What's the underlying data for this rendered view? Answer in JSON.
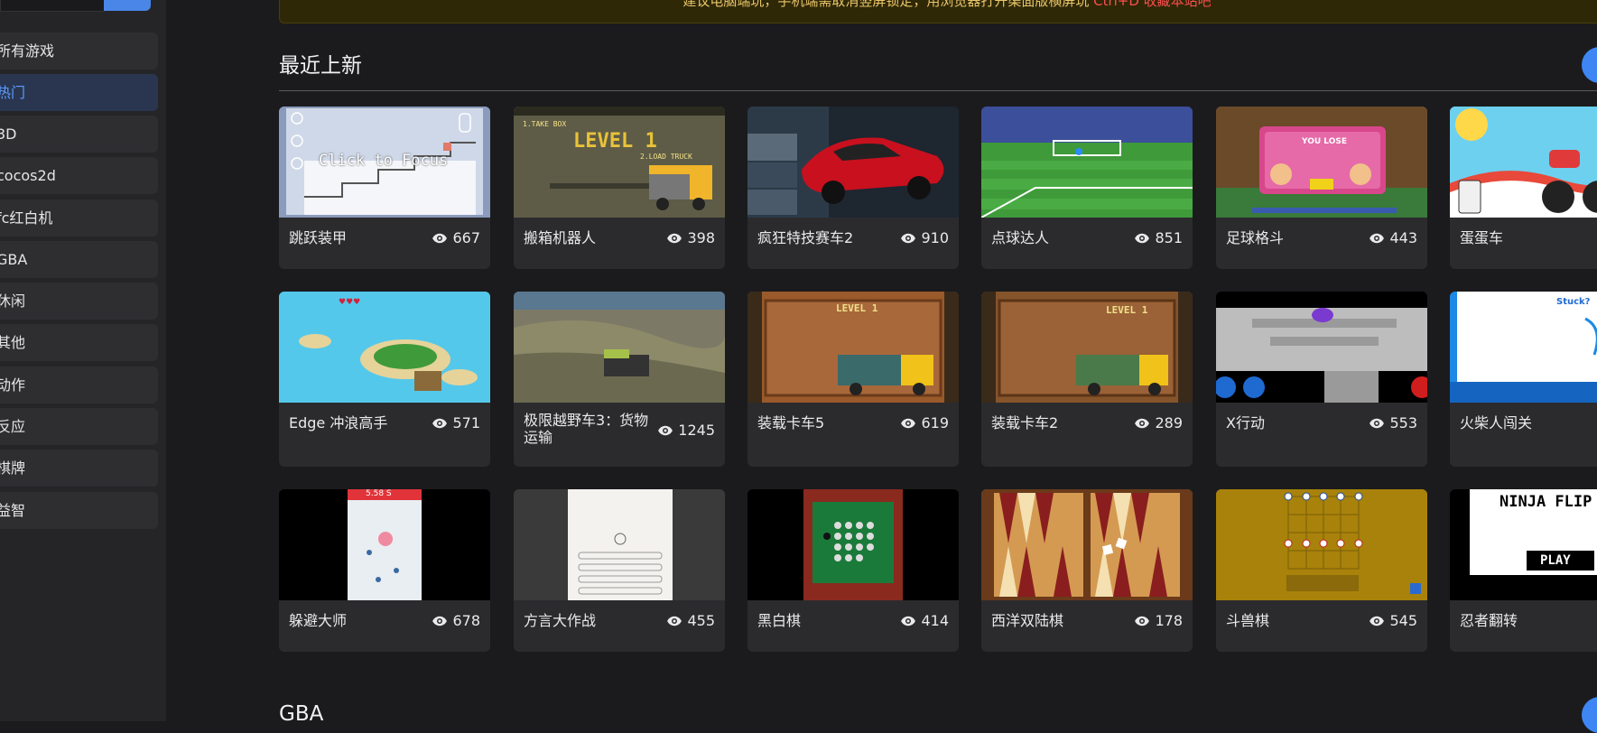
{
  "sidebar": {
    "items": [
      {
        "label": "所有游戏",
        "active": false
      },
      {
        "label": "热门",
        "active": true
      },
      {
        "label": "3D",
        "active": false
      },
      {
        "label": "cocos2d",
        "active": false
      },
      {
        "label": "fc红白机",
        "active": false
      },
      {
        "label": "GBA",
        "active": false
      },
      {
        "label": "休闲",
        "active": false
      },
      {
        "label": "其他",
        "active": false
      },
      {
        "label": "动作",
        "active": false
      },
      {
        "label": "反应",
        "active": false
      },
      {
        "label": "棋牌",
        "active": false
      },
      {
        "label": "益智",
        "active": false
      }
    ]
  },
  "notice": {
    "text": "建议电脑端玩，手机端需取消竖屏锁定，用浏览器打开渠面版横屏玩",
    "highlight": "Ctrl+D 收藏本站吧"
  },
  "sections": [
    {
      "title": "最近上新",
      "games": [
        {
          "title": "跳跃装甲",
          "views": "667"
        },
        {
          "title": "搬箱机器人",
          "views": "398"
        },
        {
          "title": "疯狂特技赛车2",
          "views": "910"
        },
        {
          "title": "点球达人",
          "views": "851"
        },
        {
          "title": "足球格斗",
          "views": "443"
        },
        {
          "title": "蛋蛋车",
          "views": ""
        },
        {
          "title": "Edge 冲浪高手",
          "views": "571"
        },
        {
          "title": "极限越野车3：货物运输",
          "views": "1245"
        },
        {
          "title": "装载卡车5",
          "views": "619"
        },
        {
          "title": "装载卡车2",
          "views": "289"
        },
        {
          "title": "X行动",
          "views": "553"
        },
        {
          "title": "火柴人闯关",
          "views": ""
        },
        {
          "title": "躲避大师",
          "views": "678"
        },
        {
          "title": "方言大作战",
          "views": "455"
        },
        {
          "title": "黑白棋",
          "views": "414"
        },
        {
          "title": "西洋双陆棋",
          "views": "178"
        },
        {
          "title": "斗兽棋",
          "views": "545"
        },
        {
          "title": "忍者翻转",
          "views": ""
        }
      ]
    },
    {
      "title": "GBA"
    }
  ],
  "thumb_text": {
    "click_to_focus": "Click to Focus",
    "level1": "LEVEL 1",
    "you_lose": "YOU LOSE",
    "dodge_timer": "5.58 S",
    "ninja_title": "NINJA FLIP",
    "ninja_play": "PLAY",
    "stuck": "Stuck?"
  },
  "colors": {
    "accent": "#3f86f5",
    "notice_highlight": "#ff4d4f"
  }
}
